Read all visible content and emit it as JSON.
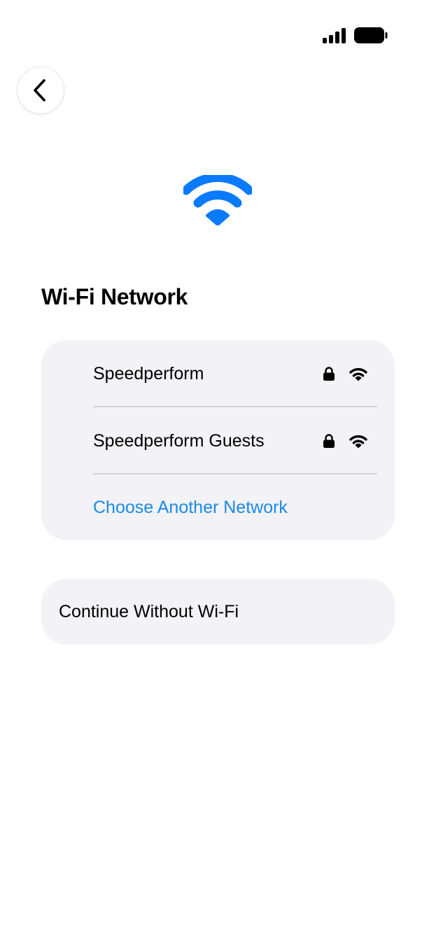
{
  "status_bar": {
    "signal_icon": "cellular-signal-icon",
    "battery_icon": "battery-full-icon"
  },
  "navigation": {
    "back_icon": "chevron-left-icon"
  },
  "hero": {
    "icon": "wifi-icon",
    "icon_color": "#0a7aff"
  },
  "title": "Wi-Fi Network",
  "networks": [
    {
      "name": "Speedperform",
      "secured": true,
      "signal": "full"
    },
    {
      "name": "Speedperform Guests",
      "secured": true,
      "signal": "full"
    }
  ],
  "choose_another": "Choose Another Network",
  "continue_without": "Continue Without Wi-Fi",
  "colors": {
    "accent": "#1a8ae5",
    "card_background": "#f2f2f7",
    "divider": "#d1d1d6"
  }
}
